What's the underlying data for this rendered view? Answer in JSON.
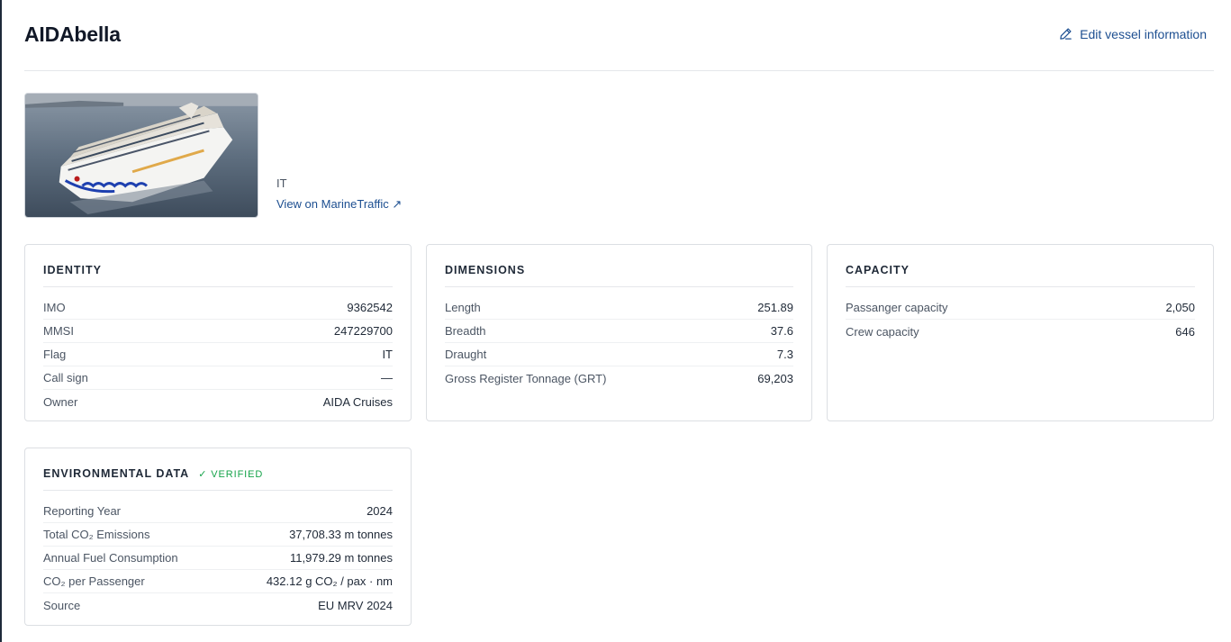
{
  "vessel": {
    "name": "AIDAbella",
    "edit_label": "Edit vessel information",
    "flag": "IT",
    "marinetraffic_label": "View on MarineTraffic ↗"
  },
  "identity": {
    "title": "IDENTITY",
    "rows": [
      {
        "label": "IMO",
        "value": "9362542"
      },
      {
        "label": "MMSI",
        "value": "247229700"
      },
      {
        "label": "Flag",
        "value": "IT"
      },
      {
        "label": "Call sign",
        "value": "—"
      },
      {
        "label": "Owner",
        "value": "AIDA Cruises"
      }
    ]
  },
  "dimensions": {
    "title": "DIMENSIONS",
    "rows": [
      {
        "label": "Length",
        "value": "251.89"
      },
      {
        "label": "Breadth",
        "value": "37.6"
      },
      {
        "label": "Draught",
        "value": "7.3"
      },
      {
        "label": "Gross Register Tonnage (GRT)",
        "value": "69,203"
      }
    ]
  },
  "capacity": {
    "title": "CAPACITY",
    "rows": [
      {
        "label": "Passanger capacity",
        "value": "2,050"
      },
      {
        "label": "Crew capacity",
        "value": "646"
      }
    ]
  },
  "environmental": {
    "title": "ENVIRONMENTAL DATA",
    "badge": "✓ VERIFIED",
    "rows": [
      {
        "label": "Reporting Year",
        "value": "2024"
      },
      {
        "label": "Total CO₂ Emissions",
        "value": "37,708.33 m tonnes"
      },
      {
        "label": "Annual Fuel Consumption",
        "value": "11,979.29 m tonnes"
      },
      {
        "label": "CO₂ per Passenger",
        "value": "432.12 g CO₂ / pax · nm"
      },
      {
        "label": "Source",
        "value": "EU MRV 2024"
      }
    ]
  },
  "colors": {
    "link": "#1d4f91",
    "verified": "#16a34a",
    "border": "#dcdfe3"
  },
  "icons": {
    "edit": "pencil-icon",
    "external": "external-link-icon",
    "check": "check-icon"
  }
}
